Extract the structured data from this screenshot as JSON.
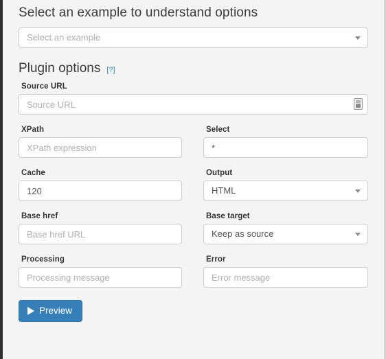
{
  "example_section": {
    "title": "Select an example to understand options",
    "select": {
      "name": "example-select",
      "value": "Select an example",
      "is_placeholder": true
    }
  },
  "plugin_section": {
    "title": "Plugin options",
    "help_label": "[?]"
  },
  "fields": {
    "source_url": {
      "label": "Source URL",
      "placeholder": "Source URL",
      "value": "",
      "icon": "autofill-icon"
    },
    "xpath": {
      "label": "XPath",
      "placeholder": "XPath expression",
      "value": ""
    },
    "select_expr": {
      "label": "Select",
      "placeholder": "",
      "value": "*"
    },
    "cache": {
      "label": "Cache",
      "placeholder": "",
      "value": "120"
    },
    "output": {
      "label": "Output",
      "value": "HTML"
    },
    "base_href": {
      "label": "Base href",
      "placeholder": "Base href URL",
      "value": ""
    },
    "base_target": {
      "label": "Base target",
      "value": "Keep as source"
    },
    "processing": {
      "label": "Processing",
      "placeholder": "Processing message",
      "value": ""
    },
    "error": {
      "label": "Error",
      "placeholder": "Error message",
      "value": ""
    }
  },
  "actions": {
    "preview": {
      "label": "Preview",
      "icon": "play-icon"
    }
  },
  "colors": {
    "background": "#f4f4f4",
    "accent_blue": "#367fb9",
    "link_blue": "#3a87c8",
    "border": "#cccccc",
    "text": "#333333",
    "placeholder": "#b0b0b0"
  }
}
